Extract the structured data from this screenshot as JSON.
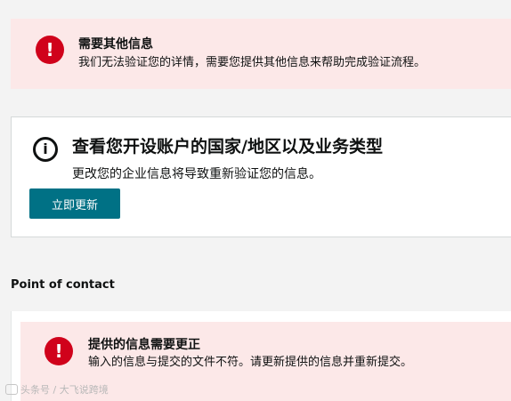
{
  "alert_top": {
    "title": "需要其他信息",
    "message": "我们无法验证您的详情，需要您提供其他信息来帮助完成验证流程。",
    "icon": "exclamation-icon"
  },
  "info_card": {
    "title": "查看您开设账户的国家/地区以及业务类型",
    "description": "更改您的企业信息将导致重新验证您的信息。",
    "button_label": "立即更新",
    "icon": "info-icon"
  },
  "section": {
    "label": "Point of contact"
  },
  "alert_bottom": {
    "title": "提供的信息需要更正",
    "message": "输入的信息与提交的文件不符。请更新提供的信息并重新提交。",
    "icon": "exclamation-icon"
  },
  "watermark": {
    "text": "头条号 / 大飞说跨境"
  },
  "colors": {
    "error": "#d0021b",
    "error_bg": "#fce8e8",
    "primary": "#007185",
    "page_bg": "#f3f3f3"
  }
}
